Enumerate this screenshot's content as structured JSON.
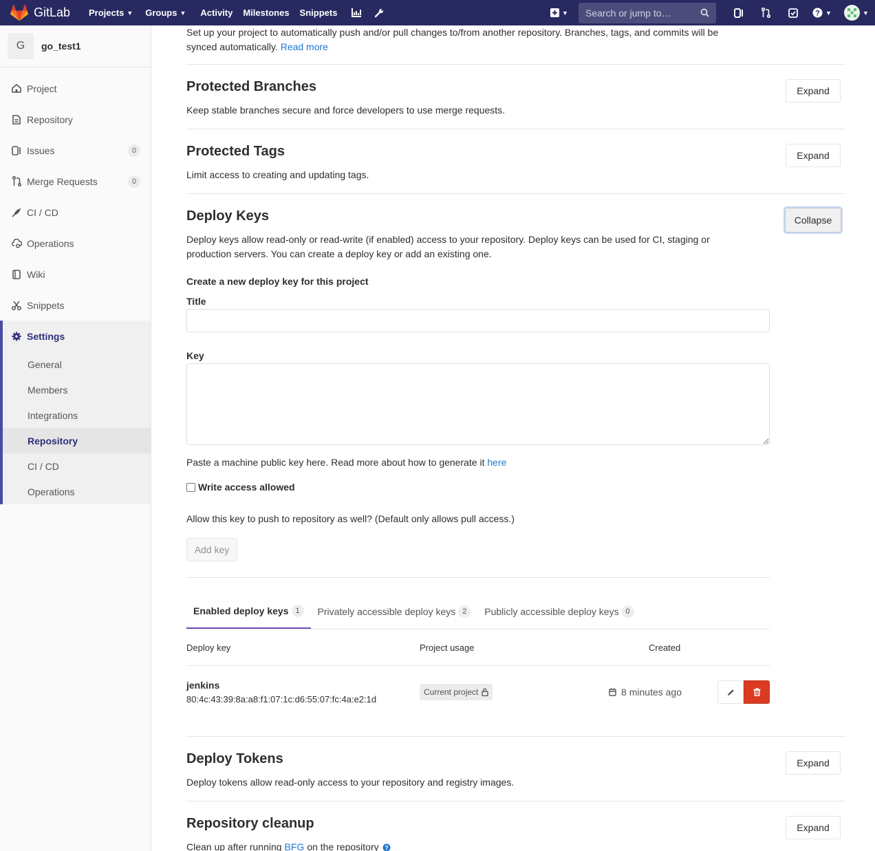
{
  "navbar": {
    "brand": "GitLab",
    "links": [
      {
        "label": "Projects",
        "caret": true
      },
      {
        "label": "Groups",
        "caret": true
      },
      {
        "label": "Activity",
        "caret": false
      },
      {
        "label": "Milestones",
        "caret": false
      },
      {
        "label": "Snippets",
        "caret": false
      }
    ],
    "search_placeholder": "Search or jump to…",
    "brand_colors": {
      "bar": "#292961"
    }
  },
  "sidebar": {
    "project_initial": "G",
    "project_name": "go_test1",
    "items": [
      {
        "label": "Project",
        "icon": "home-icon"
      },
      {
        "label": "Repository",
        "icon": "document-icon"
      },
      {
        "label": "Issues",
        "icon": "issues-icon",
        "count": "0"
      },
      {
        "label": "Merge Requests",
        "icon": "merge-request-icon",
        "count": "0"
      },
      {
        "label": "CI / CD",
        "icon": "rocket-icon"
      },
      {
        "label": "Operations",
        "icon": "cloud-gear-icon"
      },
      {
        "label": "Wiki",
        "icon": "book-icon"
      },
      {
        "label": "Snippets",
        "icon": "scissors-icon"
      }
    ],
    "settings": {
      "label": "Settings",
      "sub_items": [
        "General",
        "Members",
        "Integrations",
        "Repository",
        "CI / CD",
        "Operations"
      ],
      "active_sub": "Repository"
    }
  },
  "main": {
    "mirror_desc": "Set up your project to automatically push and/or pull changes to/from another repository. Branches, tags, and commits will be synced automatically.",
    "mirror_link": "Read more",
    "protected_branches": {
      "title": "Protected Branches",
      "desc": "Keep stable branches secure and force developers to use merge requests.",
      "button": "Expand"
    },
    "protected_tags": {
      "title": "Protected Tags",
      "desc": "Limit access to creating and updating tags.",
      "button": "Expand"
    },
    "deploy_keys": {
      "title": "Deploy Keys",
      "desc": "Deploy keys allow read-only or read-write (if enabled) access to your repository. Deploy keys can be used for CI, staging or production servers. You can create a deploy key or add an existing one.",
      "button": "Collapse",
      "form_heading": "Create a new deploy key for this project",
      "title_label": "Title",
      "title_value": "",
      "key_label": "Key",
      "key_value": "",
      "key_help": "Paste a machine public key here. Read more about how to generate it",
      "key_help_link": "here",
      "write_label": "Write access allowed",
      "write_checked": false,
      "write_help": "Allow this key to push to repository as well? (Default only allows pull access.)",
      "add_button": "Add key",
      "tabs": [
        {
          "label": "Enabled deploy keys",
          "count": "1"
        },
        {
          "label": "Privately accessible deploy keys",
          "count": "2"
        },
        {
          "label": "Publicly accessible deploy keys",
          "count": "0"
        }
      ],
      "columns": {
        "key": "Deploy key",
        "usage": "Project usage",
        "created": "Created"
      },
      "rows": [
        {
          "name": "jenkins",
          "fingerprint": "80:4c:43:39:8a:a8:f1:07:1c:d6:55:07:fc:4a:e2:1d",
          "usage": "Current project",
          "created": "8 minutes ago"
        }
      ]
    },
    "deploy_tokens": {
      "title": "Deploy Tokens",
      "desc": "Deploy tokens allow read-only access to your repository and registry images.",
      "button": "Expand"
    },
    "cleanup": {
      "title": "Repository cleanup",
      "desc_prefix": "Clean up after running",
      "desc_link": "BFG",
      "desc_suffix": "on the repository",
      "button": "Expand"
    }
  }
}
